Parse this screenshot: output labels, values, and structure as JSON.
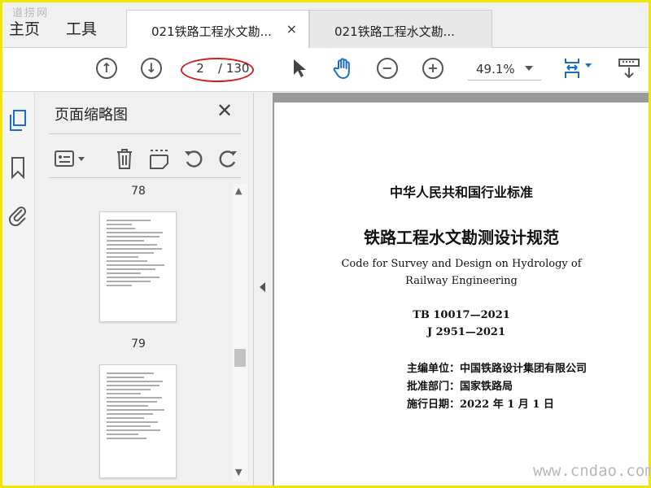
{
  "watermark_top": "道捞网",
  "tabs": {
    "home_label": "主页",
    "tools_label": "工具",
    "documents": [
      {
        "title": "021铁路工程水文勘...",
        "active": true,
        "close": "×"
      },
      {
        "title": "021铁路工程水文勘...",
        "active": false
      }
    ]
  },
  "toolbar": {
    "current_page": "2",
    "total_pages": "/ 130",
    "zoom": "49.1%",
    "icons": [
      "arrow-up-circle",
      "arrow-down-circle",
      "select-arrow",
      "hand-tool",
      "zoom-out",
      "zoom-in",
      "fit-page",
      "scroll-mode"
    ]
  },
  "rail": {
    "icons": [
      "page-thumbnails-icon",
      "bookmark-icon",
      "attachment-icon"
    ]
  },
  "pane": {
    "title": "页面缩略图",
    "close": "✕",
    "tools": [
      "options-menu",
      "delete",
      "insert-page",
      "rotate-ccw",
      "rotate-cw"
    ],
    "thumbnails": [
      {
        "label": "78"
      },
      {
        "label": "79"
      }
    ]
  },
  "document": {
    "heading": "中华人民共和国行业标准",
    "title": "铁路工程水文勘测设计规范",
    "english_line1": "Code for Survey and Design on Hydrology of",
    "english_line2": "Railway Engineering",
    "code1": "TB 10017—2021",
    "code2": "J 2951—2021",
    "editor": "主编单位：中国铁路设计集团有限公司",
    "approver": "批准部门：国家铁路局",
    "effective": "施行日期：2022 年 1 月 1 日"
  },
  "watermark_bottom": "www.cndao.com",
  "colors": {
    "frame": "#f2e500",
    "page_highlight": "#cc2222",
    "accent_blue": "#1b6ec2"
  }
}
